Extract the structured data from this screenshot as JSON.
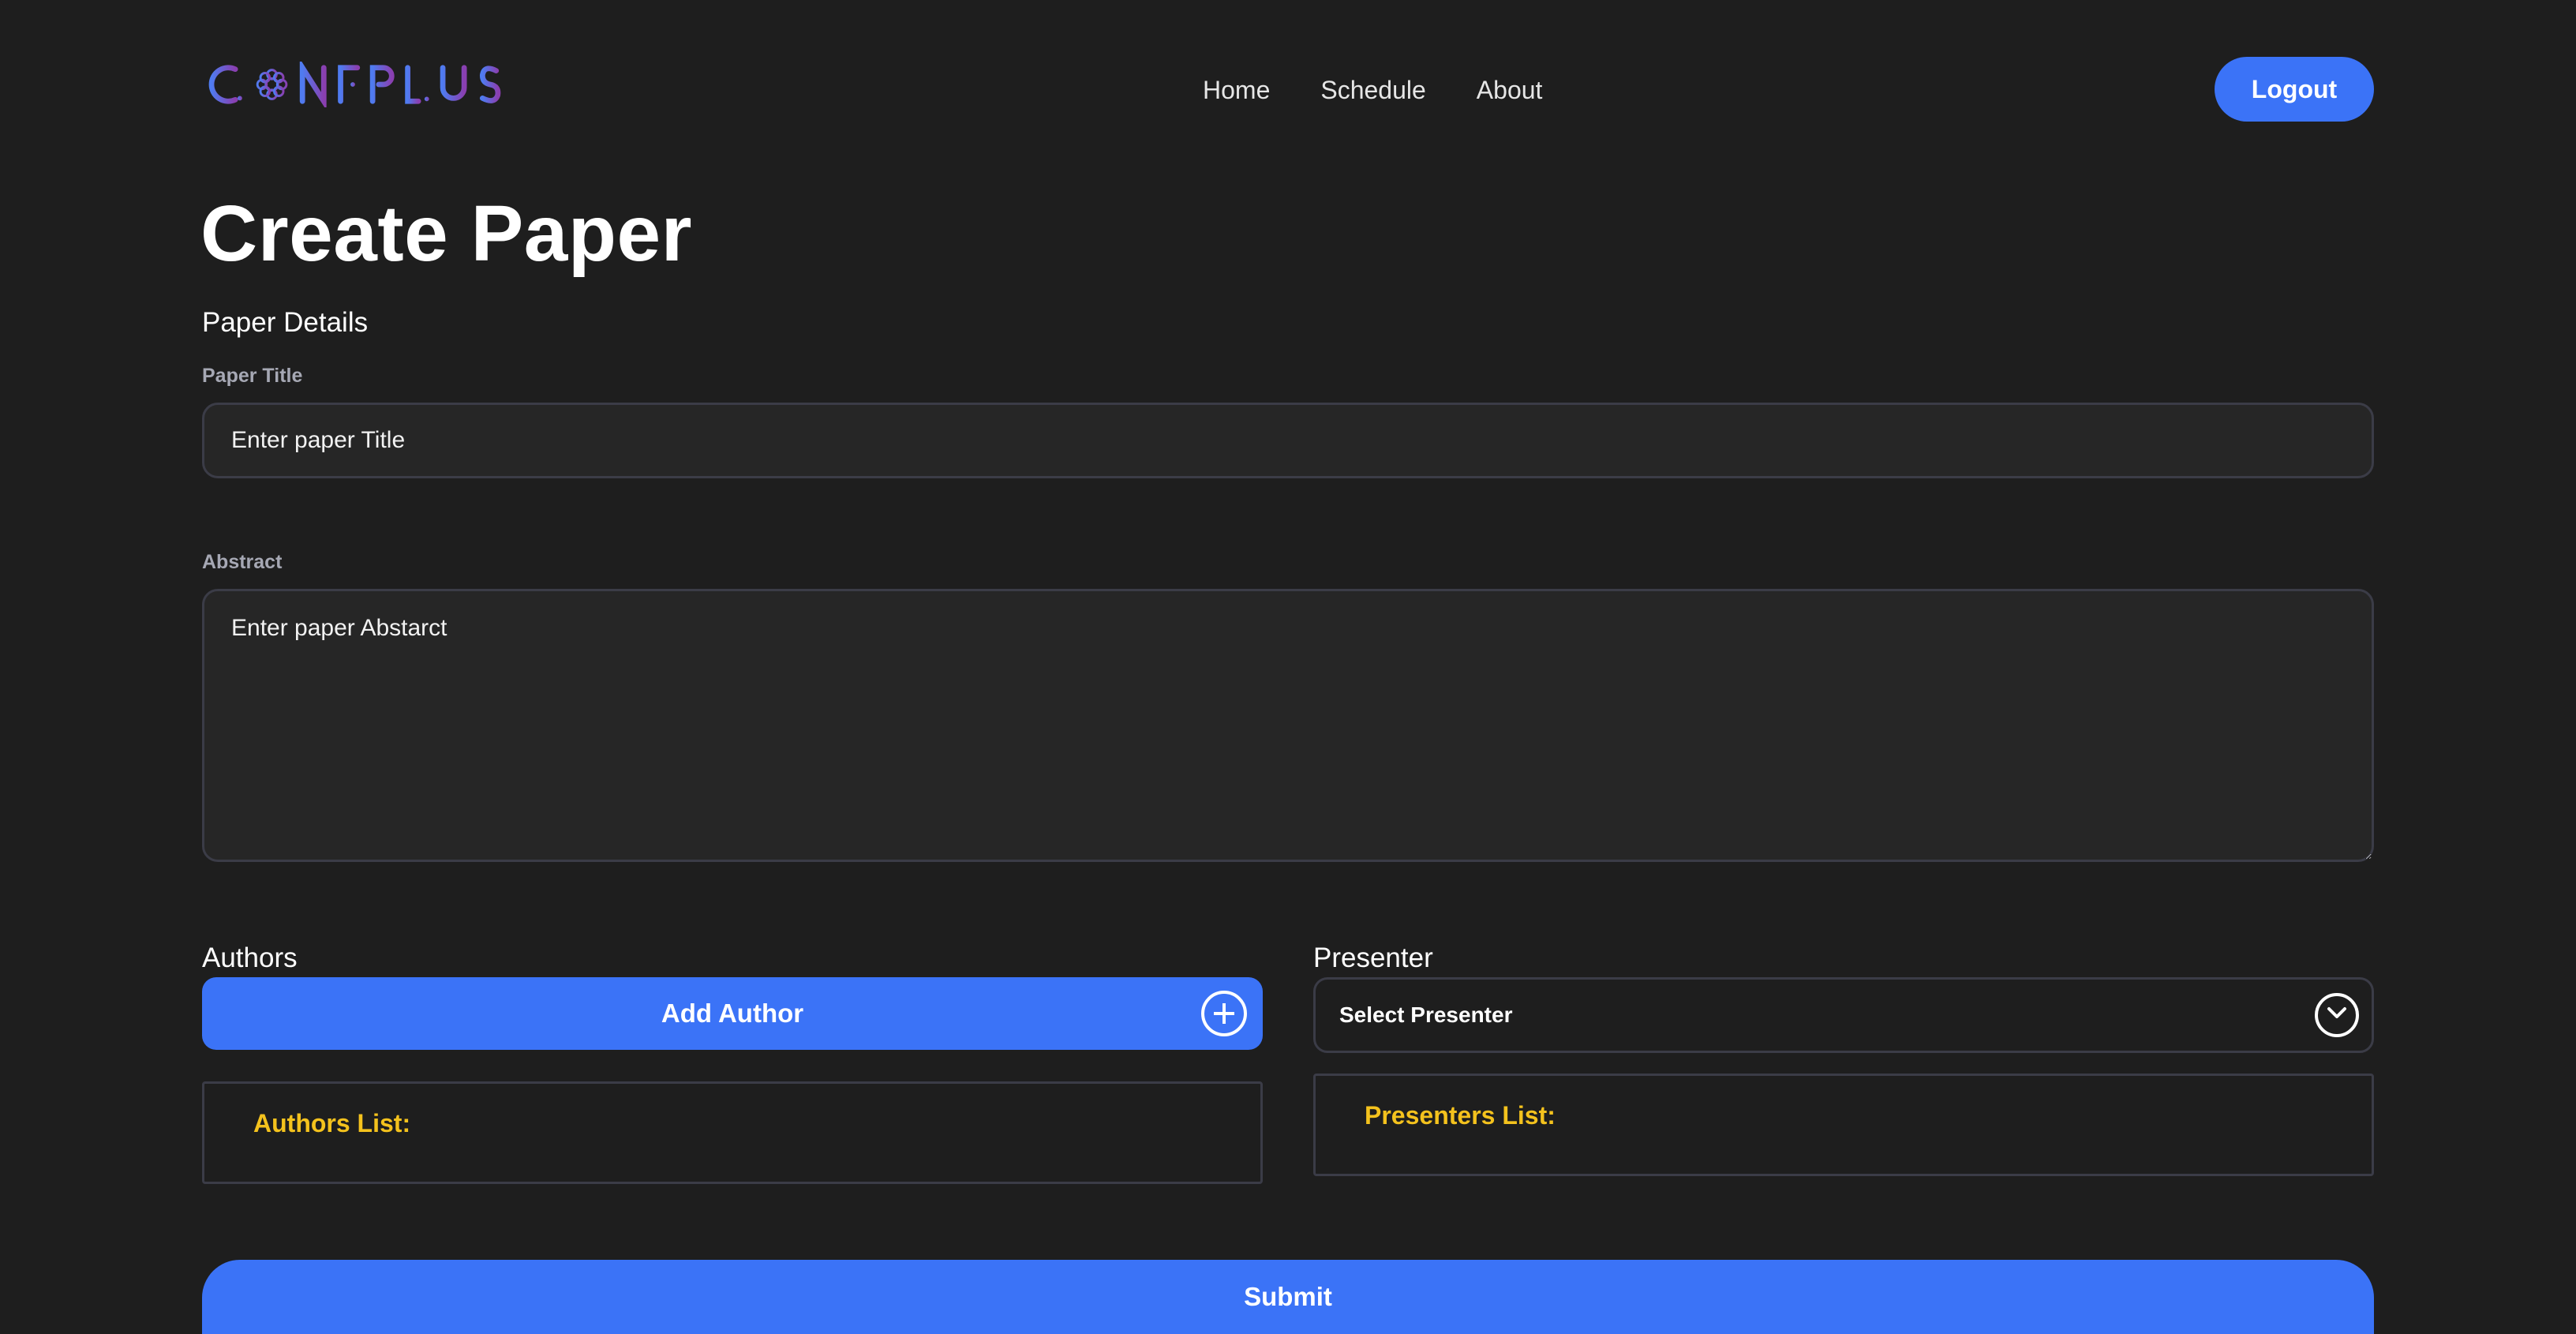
{
  "brand": {
    "name": "CONFPLUS",
    "gradient_start": "#4f7bf0",
    "gradient_end": "#8a3fb0"
  },
  "nav": {
    "items": [
      "Home",
      "Schedule",
      "About"
    ]
  },
  "header": {
    "logout_label": "Logout"
  },
  "page": {
    "title": "Create Paper",
    "section_title": "Paper Details"
  },
  "form": {
    "title_label": "Paper Title",
    "title_placeholder": "Enter paper Title",
    "abstract_label": "Abstract",
    "abstract_placeholder": "Enter paper Abstarct"
  },
  "authors": {
    "label": "Authors",
    "add_button": "Add Author",
    "list_heading": "Authors List:",
    "items": []
  },
  "presenter": {
    "label": "Presenter",
    "select_value": "Select Presenter",
    "list_heading": "Presenters List:",
    "items": []
  },
  "submit_label": "Submit",
  "colors": {
    "background": "#1e1e1e",
    "accent": "#3b73f7",
    "list_heading": "#f4c21d",
    "border": "#3b3c47"
  },
  "icons": {
    "add": "plus-circle-icon",
    "select": "chevron-down-circle-icon",
    "logo_mark": "flower-icon"
  }
}
